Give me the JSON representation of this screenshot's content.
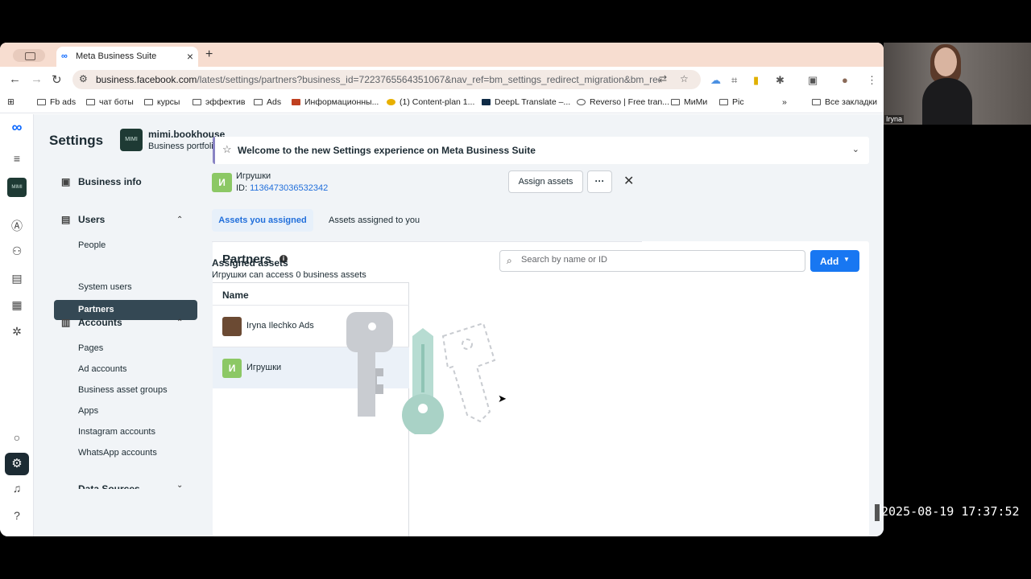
{
  "browser": {
    "tab_title": "Meta Business Suite",
    "tab_favicon": "∞",
    "url_host": "business.facebook.com",
    "url_path": "/latest/settings/partners?business_id=7223765564351067&nav_ref=bm_settings_redirect_migration&bm_redir...",
    "bookmarks": [
      "Fb ads",
      "чат боты",
      "курсы",
      "эффектив",
      "Ads",
      "Информационны...",
      "(1) Content-plan 1...",
      "DeepL Translate –...",
      "Reverso | Free tran...",
      "МиМи",
      "Pic"
    ],
    "all_bookmarks": "Все закладки"
  },
  "header": {
    "settings_title": "Settings",
    "business_name": "mimi.bookhouse",
    "business_sub": "Business portfolio",
    "logo_text": "MIMI"
  },
  "sidenav": {
    "business_info": "Business info",
    "users": "Users",
    "users_items": [
      "People",
      "Partners",
      "System users"
    ],
    "accounts": "Accounts",
    "accounts_items": [
      "Pages",
      "Ad accounts",
      "Business asset groups",
      "Apps",
      "Instagram accounts",
      "WhatsApp accounts"
    ],
    "data_sources": "Data Sources"
  },
  "banner": {
    "text": "Welcome to the new Settings experience on Meta Business Suite"
  },
  "partners": {
    "title": "Partners",
    "search_placeholder": "Search by name or ID",
    "add_label": "Add",
    "column_name": "Name",
    "rows": [
      {
        "name": "Iryna Ilechko Ads",
        "avatar": "photo"
      },
      {
        "name": "Игрушки",
        "avatar": "И"
      }
    ]
  },
  "detail": {
    "badge": "И",
    "name": "Игрушки",
    "id_label": "ID: ",
    "id_value": "1136473036532342",
    "assign_button": "Assign assets",
    "more_button": "···",
    "tab_assigned_by_you": "Assets you assigned",
    "tab_assigned_to_you": "Assets assigned to you",
    "assigned_title": "Assigned assets",
    "assigned_sub": "Игрушки can access 0 business assets"
  },
  "overlay": {
    "camera_name": "Iryna",
    "timestamp": "2025-08-19 17:37:52"
  },
  "colors": {
    "primary": "#1877f2",
    "active_nav": "#344854",
    "badge_green": "#8cc865",
    "link": "#216fdb"
  }
}
